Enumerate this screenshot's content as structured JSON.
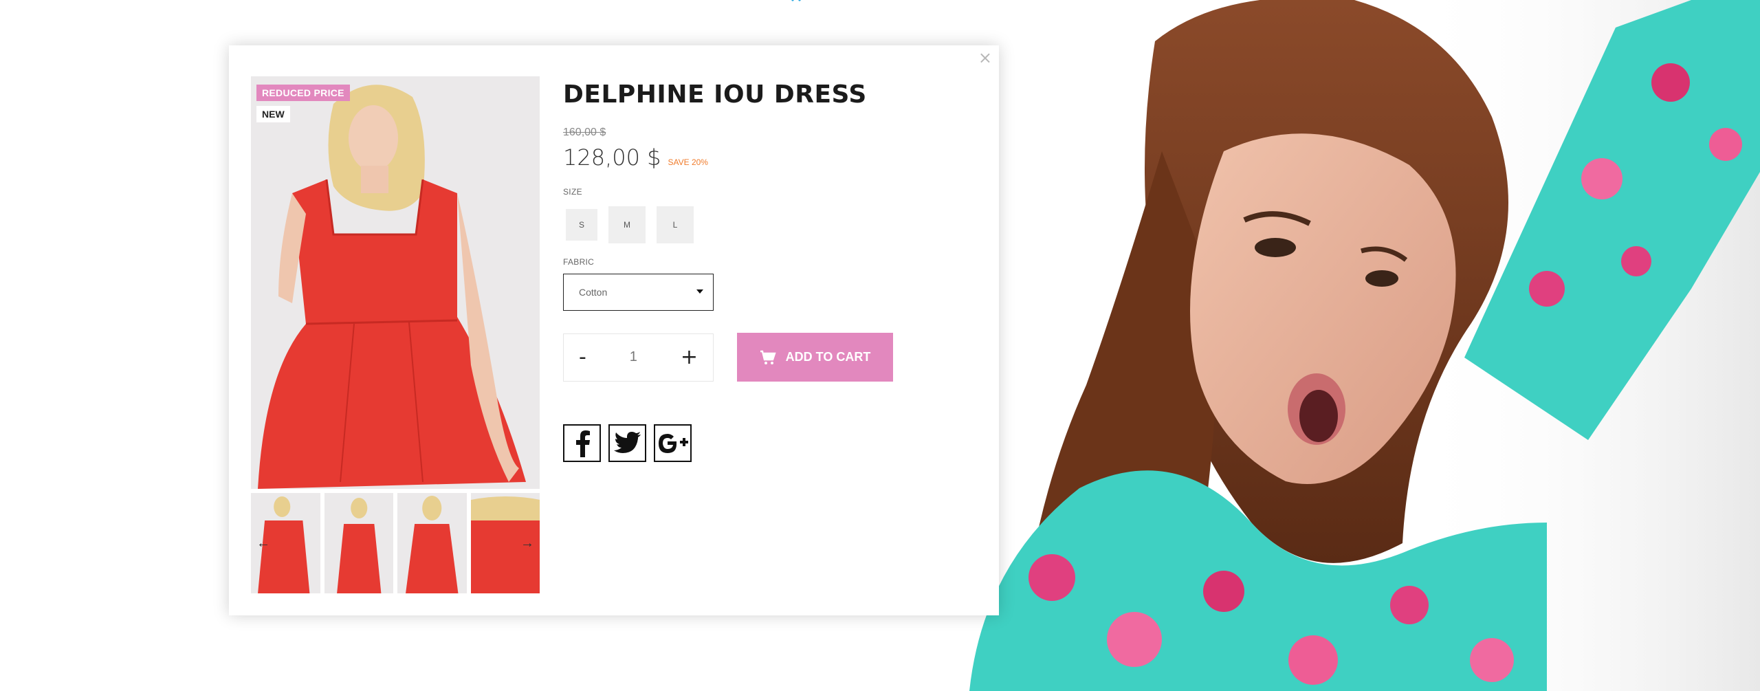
{
  "modal": {
    "close_label": "×"
  },
  "product": {
    "title": "DELPHINE IOU DRESS",
    "old_price": "160,00 $",
    "new_price": "128,00 $",
    "save_text": "SAVE 20%",
    "badges": {
      "reduced": "REDUCED PRICE",
      "new": "NEW"
    },
    "size_label": "SIZE",
    "sizes": [
      "S",
      "M",
      "L"
    ],
    "fabric_label": "FABRIC",
    "fabric_selected": "Cotton",
    "quantity": "1",
    "minus_label": "-",
    "plus_label": "+",
    "add_to_cart_label": "ADD TO CART"
  },
  "colors": {
    "accent_pink": "#e288be",
    "save_orange": "#f07c2c",
    "dress_red": "#e63a32"
  },
  "icons": {
    "cart": "cart-icon",
    "facebook": "facebook-icon",
    "twitter": "twitter-icon",
    "googleplus": "google-plus-icon",
    "arrow_left": "arrow-left-icon",
    "arrow_right": "arrow-right-icon",
    "close": "close-icon"
  }
}
